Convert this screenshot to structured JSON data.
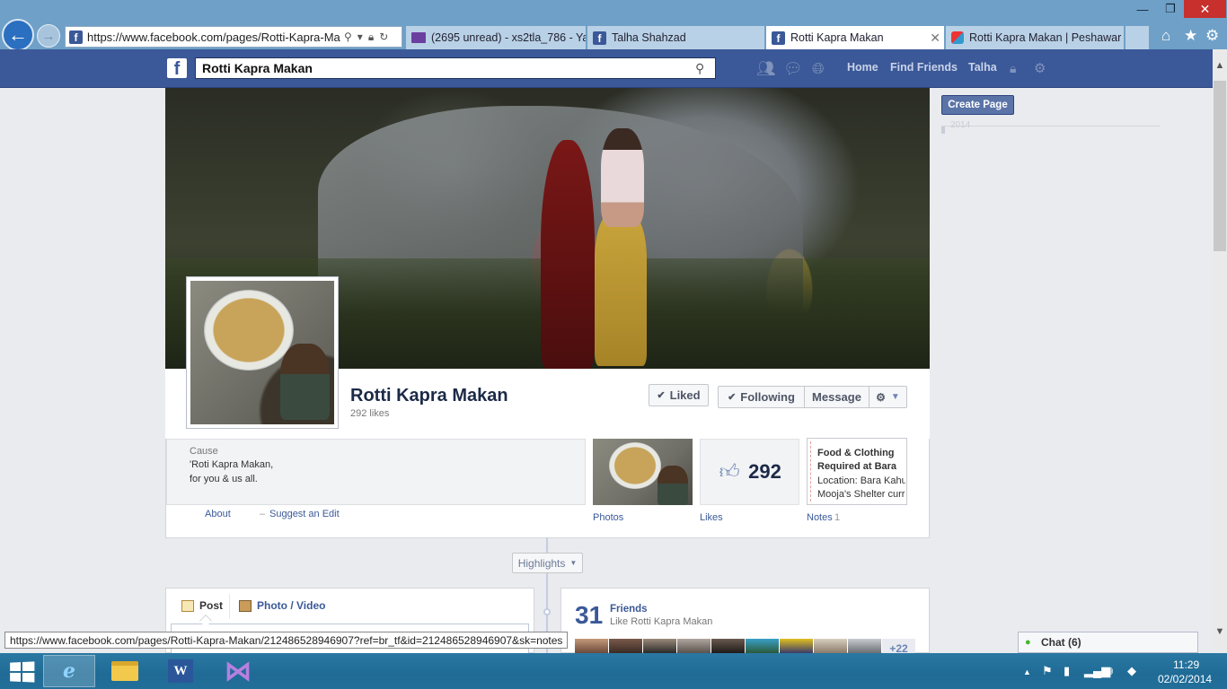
{
  "browser": {
    "url": "https://www.facebook.com/pages/Rotti-Kapra-Makan",
    "tabs": [
      {
        "label": "(2695 unread) - xs2tla_786 - Ya...",
        "icon": "mail-icon",
        "active": false
      },
      {
        "label": "Talha Shahzad",
        "icon": "facebook-icon",
        "active": false
      },
      {
        "label": "Rotti Kapra Makan",
        "icon": "facebook-icon",
        "active": true
      },
      {
        "label": "Rotti Kapra Makan | Peshawar ...",
        "icon": "multicolor-icon",
        "active": false
      }
    ],
    "tab_close": "✕",
    "icons": [
      "home-icon",
      "star-icon",
      "gear-icon"
    ],
    "status_url": "https://www.facebook.com/pages/Rotti-Kapra-Makan/212486528946907?ref=br_tf&id=212486528946907&sk=notes"
  },
  "topbar": {
    "search_value": "Rotti Kapra Makan",
    "nav": {
      "home": "Home",
      "find_friends": "Find Friends",
      "user": "Talha"
    }
  },
  "page": {
    "name": "Rotti Kapra Makan",
    "likes_text": "292 likes",
    "buttons": {
      "liked": "Liked",
      "following": "Following",
      "message": "Message"
    }
  },
  "about": {
    "category": "Cause",
    "line1": "'Roti Kapra Makan,",
    "line2": "for you & us all.",
    "about_link": "About",
    "separator": "–",
    "suggest_link": "Suggest an Edit"
  },
  "apps": {
    "photos_label": "Photos",
    "likes_count": "292",
    "likes_label": "Likes",
    "notes": {
      "title1": "Food & Clothing",
      "title2": "Required at Bara",
      "body1": "Location: Bara Kahu",
      "body2": "Mooja's Shelter curr"
    },
    "notes_label": "Notes",
    "notes_count": "1"
  },
  "right": {
    "create_page": "Create Page",
    "year": "2014"
  },
  "timeline": {
    "highlights": "Highlights",
    "composer": {
      "post": "Post",
      "photo_video": "Photo / Video"
    },
    "friends": {
      "count": "31",
      "title": "Friends",
      "subtitle": "Like Rotti Kapra Makan",
      "more": "+22"
    }
  },
  "chat": {
    "label": "Chat (6)"
  },
  "taskbar": {
    "apps": [
      "internet-explorer",
      "file-explorer",
      "microsoft-word",
      "visual-studio"
    ],
    "time": "11:29",
    "date": "02/02/2014"
  },
  "colors": {
    "facebook_blue": "#3b5998",
    "chrome_blue": "#6fa0c7",
    "close_red": "#c7302c",
    "taskbar": "#2a78a3"
  }
}
